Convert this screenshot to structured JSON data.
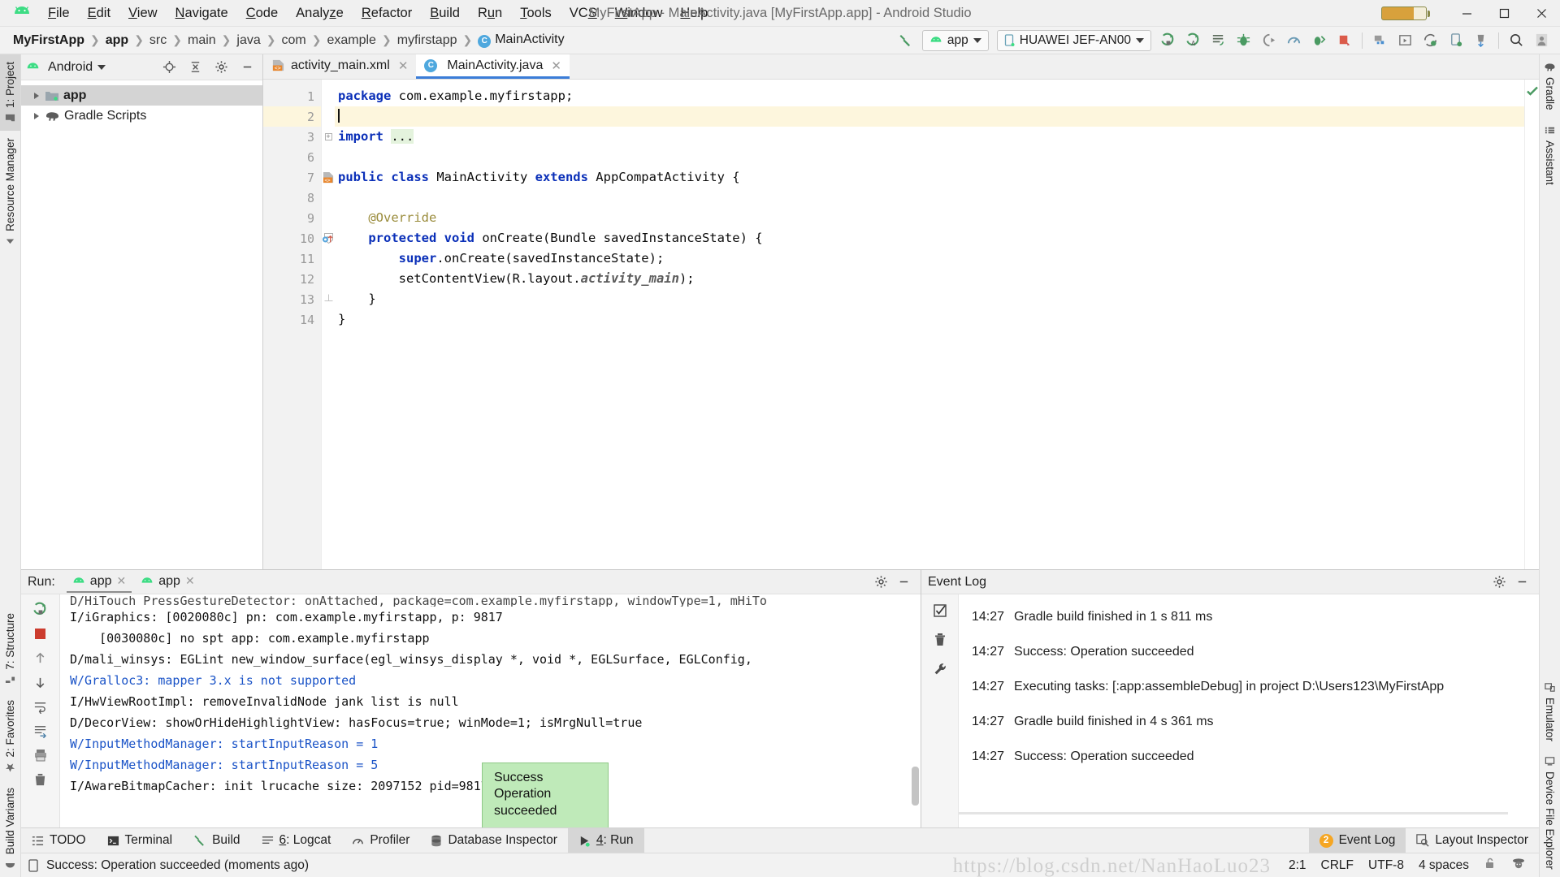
{
  "window": {
    "title": "MyFirstApp - MainActivity.java [MyFirstApp.app] - Android Studio",
    "minimize": "—",
    "maximize": "❐",
    "close": "✕"
  },
  "menu": [
    {
      "label": "File",
      "accel": "F"
    },
    {
      "label": "Edit",
      "accel": "E"
    },
    {
      "label": "View",
      "accel": "V"
    },
    {
      "label": "Navigate",
      "accel": "N"
    },
    {
      "label": "Code",
      "accel": "C"
    },
    {
      "label": "Analyze",
      "accel": "z"
    },
    {
      "label": "Refactor",
      "accel": "R"
    },
    {
      "label": "Build",
      "accel": "B"
    },
    {
      "label": "Run",
      "accel": "u"
    },
    {
      "label": "Tools",
      "accel": "T"
    },
    {
      "label": "VCS",
      "accel": "S"
    },
    {
      "label": "Window",
      "accel": "W"
    },
    {
      "label": "Help",
      "accel": "H"
    }
  ],
  "breadcrumb": [
    {
      "label": "MyFirstApp",
      "bold": true
    },
    {
      "label": "app",
      "bold": true
    },
    {
      "label": "src",
      "bold": false
    },
    {
      "label": "main",
      "bold": false
    },
    {
      "label": "java",
      "bold": false
    },
    {
      "label": "com",
      "bold": false
    },
    {
      "label": "example",
      "bold": false
    },
    {
      "label": "myfirstapp",
      "bold": false
    },
    {
      "label": "MainActivity",
      "bold": false,
      "icon": "C"
    }
  ],
  "toolbar": {
    "build_hammer": "build-icon",
    "run_config": "app",
    "device": "HUAWEI JEF-AN00",
    "icons": [
      "run-icon",
      "apply-changes-icon",
      "apply-code-changes-icon",
      "debug-icon",
      "attach-debugger-icon",
      "profiler-icon",
      "run-with-coverage-icon",
      "stop-icon",
      "sdk-manager-icon",
      "avd-manager-icon",
      "sync-gradle-icon",
      "device-manager-icon",
      "resource-manager-icon",
      "search-icon",
      "account-icon"
    ]
  },
  "rail_left": [
    {
      "label": "1: Project",
      "selected": true,
      "icon": "folder-icon"
    },
    {
      "label": "Resource Manager",
      "selected": false,
      "icon": "resource-icon"
    },
    {
      "label": "7: Structure",
      "selected": false,
      "icon": "structure-icon"
    },
    {
      "label": "2: Favorites",
      "selected": false,
      "icon": "star-icon"
    },
    {
      "label": "Build Variants",
      "selected": false,
      "icon": "variants-icon"
    }
  ],
  "rail_right_top": [
    {
      "label": "Gradle",
      "icon": "gradle-elephant-icon"
    },
    {
      "label": "Assistant",
      "icon": "assistant-icon"
    }
  ],
  "rail_right_bottom": [
    {
      "label": "Emulator",
      "icon": "emulator-icon"
    },
    {
      "label": "Device File Explorer",
      "icon": "device-file-explorer-icon"
    }
  ],
  "project_panel": {
    "title": "Android",
    "actions": [
      "locate-icon",
      "collapse-all-icon",
      "settings-icon",
      "hide-icon"
    ],
    "tree": [
      {
        "label": "app",
        "bold": true,
        "selected": true,
        "icon": "module-icon"
      },
      {
        "label": "Gradle Scripts",
        "bold": false,
        "selected": false,
        "icon": "gradle-elephant-icon"
      }
    ]
  },
  "editor": {
    "tabs": [
      {
        "label": "activity_main.xml",
        "active": false,
        "icon": "xml-layout-icon"
      },
      {
        "label": "MainActivity.java",
        "active": true,
        "icon": "java-class-icon"
      }
    ],
    "gutter_lines": [
      "1",
      "2",
      "3",
      "6",
      "7",
      "8",
      "9",
      "10",
      "11",
      "12",
      "13",
      "14"
    ],
    "current_line_index": 1,
    "lines": [
      {
        "n": "1",
        "segments": [
          {
            "t": "package",
            "c": "kw"
          },
          {
            "t": " com.example.myfirstapp;",
            "c": ""
          }
        ]
      },
      {
        "n": "2",
        "segments": [
          {
            "t": "",
            "c": "caret"
          }
        ]
      },
      {
        "n": "3",
        "segments": [
          {
            "t": "import",
            "c": "kw"
          },
          {
            "t": " ",
            "c": ""
          },
          {
            "t": "...",
            "c": "fldbg"
          }
        ]
      },
      {
        "n": "6",
        "segments": []
      },
      {
        "n": "7",
        "segments": [
          {
            "t": "public class",
            "c": "kw"
          },
          {
            "t": " MainActivity ",
            "c": ""
          },
          {
            "t": "extends",
            "c": "kw"
          },
          {
            "t": " AppCompatActivity {",
            "c": ""
          }
        ]
      },
      {
        "n": "8",
        "segments": []
      },
      {
        "n": "9",
        "segments": [
          {
            "t": "    @Override",
            "c": "ann"
          }
        ]
      },
      {
        "n": "10",
        "segments": [
          {
            "t": "    protected void",
            "c": "kw"
          },
          {
            "t": " onCreate(Bundle savedInstanceState) {",
            "c": ""
          }
        ]
      },
      {
        "n": "11",
        "segments": [
          {
            "t": "        super",
            "c": "kw"
          },
          {
            "t": ".onCreate(savedInstanceState);",
            "c": ""
          }
        ]
      },
      {
        "n": "12",
        "segments": [
          {
            "t": "        setContentView(R.layout.",
            "c": ""
          },
          {
            "t": "activity_main",
            "c": "fld"
          },
          {
            "t": ");",
            "c": ""
          }
        ]
      },
      {
        "n": "13",
        "segments": [
          {
            "t": "    }",
            "c": ""
          }
        ]
      },
      {
        "n": "14",
        "segments": [
          {
            "t": "}",
            "c": ""
          }
        ]
      }
    ],
    "inspection_status": "ok-check-icon"
  },
  "run_panel": {
    "title": "Run:",
    "tabs": [
      {
        "label": "app",
        "active": true
      },
      {
        "label": "app",
        "active": false
      }
    ],
    "actions": [
      "settings-icon",
      "hide-icon"
    ],
    "side_actions": [
      "rerun-icon",
      "stop-icon",
      "up-arrow-icon",
      "down-arrow-icon",
      "soft-wrap-icon",
      "scroll-to-end-icon",
      "print-icon",
      "clear-all-icon"
    ],
    "console": [
      {
        "text": "D/HiTouch_PressGestureDetector: onAttached, package=com.example.myfirstapp, windowType=1, mHiTo",
        "clipped": true,
        "warn": false
      },
      {
        "text": "I/iGraphics: [0020080c] pn: com.example.myfirstapp, p: 9817",
        "clipped": false,
        "warn": false
      },
      {
        "text": "    [0030080c] no spt app: com.example.myfirstapp",
        "clipped": false,
        "warn": false
      },
      {
        "text": "D/mali_winsys: EGLint new_window_surface(egl_winsys_display *, void *, EGLSurface, EGLConfig,",
        "clipped": false,
        "warn": false
      },
      {
        "text": "W/Gralloc3: mapper 3.x is not supported",
        "clipped": false,
        "warn": true
      },
      {
        "text": "I/HwViewRootImpl: removeInvalidNode jank list is null",
        "clipped": false,
        "warn": false
      },
      {
        "text": "D/DecorView: showOrHideHighlightView: hasFocus=true; winMode=1; isMrgNull=true",
        "clipped": false,
        "warn": false
      },
      {
        "text": "W/InputMethodManager: startInputReason = 1",
        "clipped": false,
        "warn": true
      },
      {
        "text": "W/InputMethodManager: startInputReason = 5",
        "clipped": false,
        "warn": true
      },
      {
        "text": "I/AwareBitmapCacher: init lrucache size: 2097152 pid=9817",
        "clipped": false,
        "warn": false
      }
    ]
  },
  "toast": {
    "title": "Success",
    "message": "Operation succeeded",
    "bg": "#bfeab9"
  },
  "event_log": {
    "title": "Event Log",
    "actions": [
      "mark-read-icon",
      "delete-icon",
      "settings-wrench-icon"
    ],
    "entries": [
      {
        "time": "14:27",
        "text": "Gradle build finished in 1 s 811 ms"
      },
      {
        "time": "14:27",
        "text": "Success: Operation succeeded"
      },
      {
        "time": "14:27",
        "text": "Executing tasks: [:app:assembleDebug] in project D:\\Users123\\MyFirstApp"
      },
      {
        "time": "14:27",
        "text": "Gradle build finished in 4 s 361 ms"
      },
      {
        "time": "14:27",
        "text": "Success: Operation succeeded"
      }
    ]
  },
  "toolwindow_bar": {
    "left": [
      {
        "label": "TODO",
        "icon": "todo-icon",
        "selected": false,
        "accel": ""
      },
      {
        "label": "Terminal",
        "icon": "terminal-icon",
        "selected": false,
        "accel": ""
      },
      {
        "label": "Build",
        "icon": "build-hammer-icon",
        "selected": false,
        "accel": ""
      },
      {
        "label": "6: Logcat",
        "icon": "logcat-icon",
        "selected": false,
        "accel": "6"
      },
      {
        "label": "Profiler",
        "icon": "profiler-icon",
        "selected": false,
        "accel": ""
      },
      {
        "label": "Database Inspector",
        "icon": "database-icon",
        "selected": false,
        "accel": ""
      },
      {
        "label": "4: Run",
        "icon": "run-green-icon",
        "selected": true,
        "accel": "4"
      }
    ],
    "right": [
      {
        "label": "Event Log",
        "icon": "event-log-icon",
        "selected": true,
        "badge": "2"
      },
      {
        "label": "Layout Inspector",
        "icon": "layout-inspector-icon",
        "selected": false,
        "badge": ""
      }
    ]
  },
  "status_bar": {
    "icon": "device-icon",
    "message": "Success: Operation succeeded (moments ago)",
    "caret_position": "2:1",
    "line_separator": "CRLF",
    "encoding": "UTF-8",
    "indent": "4 spaces",
    "lock_icon": "unlocked-icon",
    "inspector_icon": "inspector-hector-icon"
  },
  "watermark": "https://blog.csdn.net/NanHaoLuo23",
  "colors": {
    "accent": "#3b7dd8",
    "android_green": "#3ddc84",
    "warning": "#1a53c7",
    "badge": "#f5a623",
    "success_bg": "#bfeab9"
  }
}
